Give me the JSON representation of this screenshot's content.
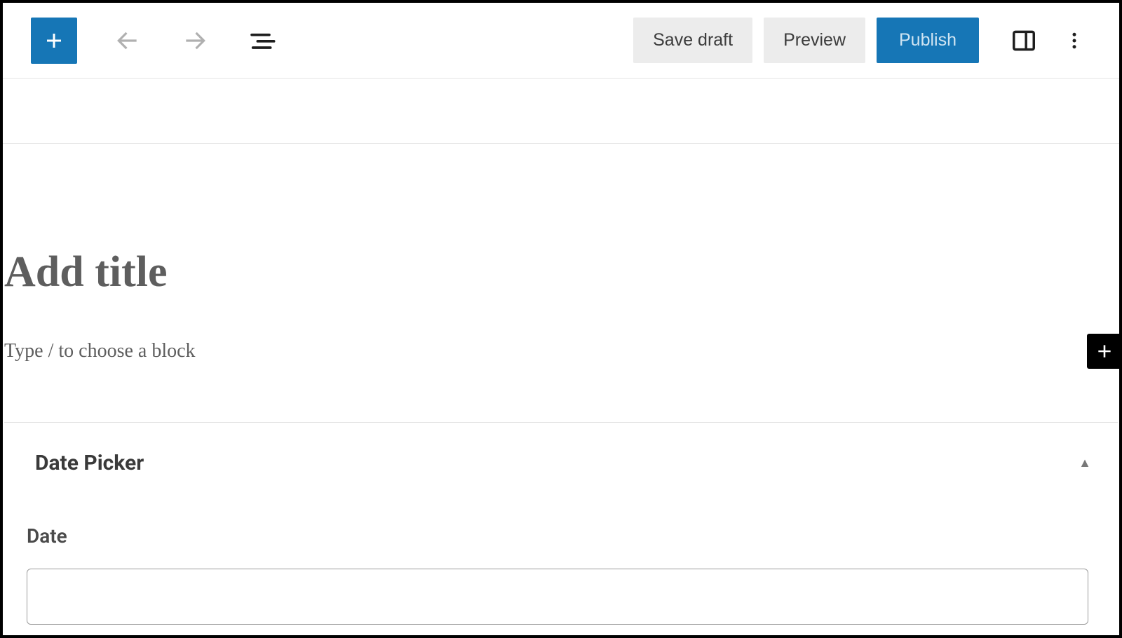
{
  "toolbar": {
    "save_draft_label": "Save draft",
    "preview_label": "Preview",
    "publish_label": "Publish"
  },
  "editor": {
    "title_placeholder": "Add title",
    "block_placeholder": "Type / to choose a block"
  },
  "panel": {
    "title": "Date Picker",
    "field_label": "Date",
    "field_value": ""
  }
}
